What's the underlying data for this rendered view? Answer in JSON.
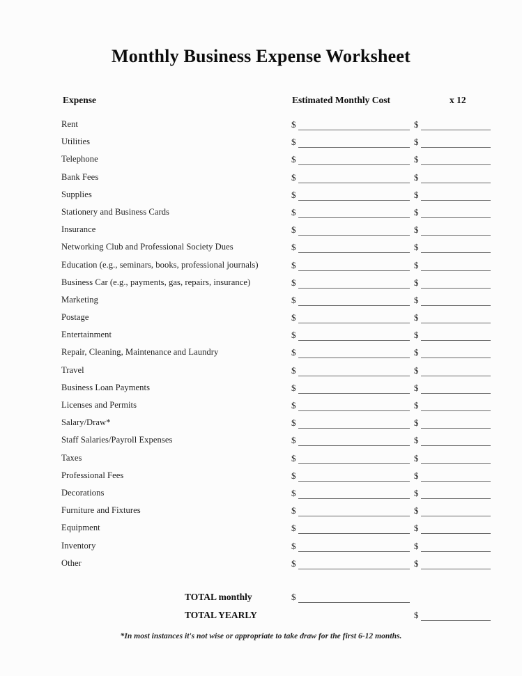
{
  "document": {
    "title": "Monthly Business Expense Worksheet"
  },
  "table": {
    "headers": {
      "expense": "Expense",
      "monthly_cost": "Estimated Monthly Cost",
      "multiplier": "x 12"
    },
    "currency_symbol": "$",
    "rows": [
      {
        "label": "Rent"
      },
      {
        "label": "Utilities"
      },
      {
        "label": "Telephone"
      },
      {
        "label": "Bank Fees"
      },
      {
        "label": "Supplies"
      },
      {
        "label": "Stationery and Business Cards"
      },
      {
        "label": "Insurance"
      },
      {
        "label": "Networking Club and Professional Society Dues"
      },
      {
        "label": "Education (e.g., seminars, books, professional journals)"
      },
      {
        "label": "Business Car (e.g., payments, gas, repairs, insurance)"
      },
      {
        "label": "Marketing"
      },
      {
        "label": "Postage"
      },
      {
        "label": "Entertainment"
      },
      {
        "label": "Repair, Cleaning, Maintenance and Laundry"
      },
      {
        "label": "Travel"
      },
      {
        "label": "Business Loan Payments"
      },
      {
        "label": "Licenses and Permits"
      },
      {
        "label": "Salary/Draw*"
      },
      {
        "label": "Staff Salaries/Payroll Expenses"
      },
      {
        "label": "Taxes"
      },
      {
        "label": "Professional Fees"
      },
      {
        "label": "Decorations"
      },
      {
        "label": "Furniture and Fixtures"
      },
      {
        "label": "Equipment"
      },
      {
        "label": "Inventory"
      },
      {
        "label": "Other"
      }
    ]
  },
  "totals": {
    "monthly_label": "TOTAL monthly",
    "yearly_label": "TOTAL YEARLY",
    "currency_symbol": "$"
  },
  "footnote": {
    "text": "*In most instances it's not wise or appropriate to take draw for the first 6-12 months."
  }
}
